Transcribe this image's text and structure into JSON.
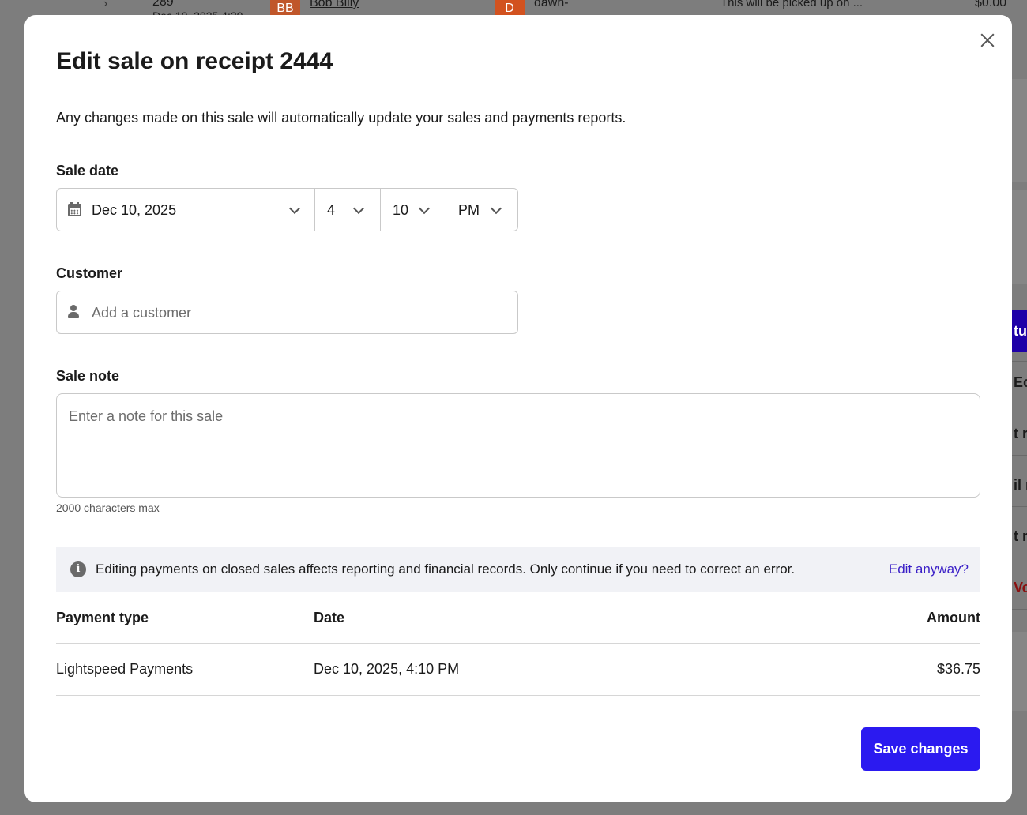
{
  "background": {
    "receipt_number": "289",
    "date_partial": "Dec 10, 2025 4:20",
    "avatar_initials": "BB",
    "customer_name": "Bob Billy",
    "employee_initial": "D",
    "employee_name": "dawn-",
    "note_preview": "This will be picked up on ...",
    "amount": "$0.00",
    "side_labels": [
      "tu",
      "Ec",
      "t re",
      "il r",
      "t r",
      "Vo"
    ]
  },
  "modal": {
    "title": "Edit sale on receipt 2444",
    "description": "Any changes made on this sale will automatically update your sales and payments reports.",
    "sale_date": {
      "label": "Sale date",
      "date": "Dec 10, 2025",
      "hour": "4",
      "minute": "10",
      "meridiem": "PM"
    },
    "customer": {
      "label": "Customer",
      "placeholder": "Add a customer"
    },
    "sale_note": {
      "label": "Sale note",
      "placeholder": "Enter a note for this sale",
      "hint": "2000 characters max"
    },
    "banner": {
      "message": "Editing payments on closed sales affects reporting and financial records. Only continue if you need to correct an error.",
      "link": "Edit anyway?"
    },
    "payments": {
      "headers": {
        "type": "Payment type",
        "date": "Date",
        "amount": "Amount"
      },
      "rows": [
        {
          "type": "Lightspeed Payments",
          "date": "Dec 10, 2025, 4:10 PM",
          "amount": "$36.75"
        }
      ]
    },
    "save_label": "Save changes"
  },
  "colors": {
    "primary": "#2b1af0",
    "link": "#3a1fc7",
    "overlay": "#7d7d7d",
    "avatar_bb": "#c0562a",
    "avatar_d": "#d2521f"
  }
}
